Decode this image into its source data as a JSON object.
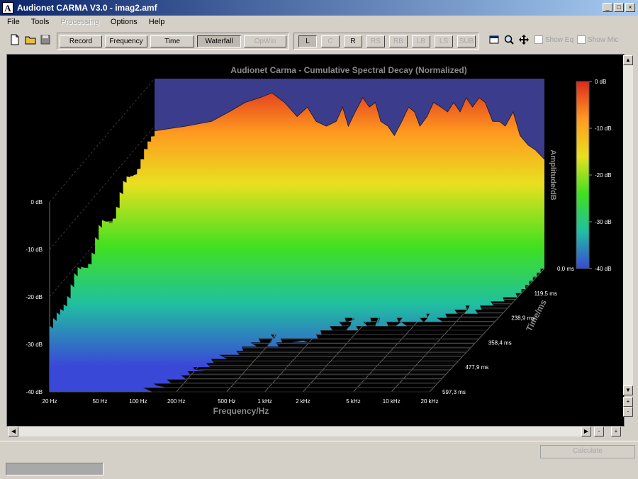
{
  "window": {
    "title": "Audionet CARMA V3.0 - imag2.amf",
    "logo_letter": "A"
  },
  "window_controls": {
    "minimize": "_",
    "maximize": "□",
    "close": "×"
  },
  "menu": [
    {
      "label": "File",
      "enabled": true
    },
    {
      "label": "Tools",
      "enabled": true
    },
    {
      "label": "Processing",
      "enabled": false
    },
    {
      "label": "Options",
      "enabled": true
    },
    {
      "label": "Help",
      "enabled": true
    }
  ],
  "toolbar": {
    "file_icons": [
      "new-file-icon",
      "open-folder-icon",
      "save-disk-icon"
    ],
    "mode_buttons": [
      {
        "label": "Record",
        "pressed": false,
        "enabled": true
      },
      {
        "label": "Frequency",
        "pressed": false,
        "enabled": true
      },
      {
        "label": "Time",
        "pressed": false,
        "enabled": true
      },
      {
        "label": "Waterfall",
        "pressed": true,
        "enabled": true
      },
      {
        "label": "OpWin",
        "pressed": false,
        "enabled": false
      }
    ],
    "channel_buttons": [
      {
        "label": "L",
        "pressed": true,
        "enabled": true
      },
      {
        "label": "C",
        "pressed": false,
        "enabled": false
      },
      {
        "label": "R",
        "pressed": false,
        "enabled": true
      },
      {
        "label": "RS",
        "pressed": false,
        "enabled": false
      },
      {
        "label": "RB",
        "pressed": false,
        "enabled": false
      },
      {
        "label": "LB",
        "pressed": false,
        "enabled": false
      },
      {
        "label": "LS",
        "pressed": false,
        "enabled": false
      },
      {
        "label": "SUB",
        "pressed": false,
        "enabled": false
      }
    ],
    "view_icons": [
      "window-icon",
      "zoom-icon",
      "pan-icon"
    ],
    "checkboxes": [
      {
        "label": "Show Eq",
        "checked": false,
        "enabled": false
      },
      {
        "label": "Show Mic",
        "checked": false,
        "enabled": false
      }
    ]
  },
  "chart_data": {
    "type": "waterfall",
    "title": "Audionet Carma - Cumulative Spectral Decay (Normalized)",
    "xlabel": "Frequency/Hz",
    "ylabel": "Amplitude/dB",
    "zlabel": "Time/ms",
    "x_ticks": [
      "20 Hz",
      "50 Hz",
      "100 Hz",
      "200 Hz",
      "500 Hz",
      "1 kHz",
      "2 kHz",
      "5 kHz",
      "10 kHz",
      "20 kHz"
    ],
    "x_tick_hz": [
      20,
      50,
      100,
      200,
      500,
      1000,
      2000,
      5000,
      10000,
      20000
    ],
    "y_ticks": [
      "0 dB",
      "-10 dB",
      "-20 dB",
      "-30 dB",
      "-40 dB"
    ],
    "y_tick_db": [
      0,
      -10,
      -20,
      -30,
      -40
    ],
    "time_ticks": [
      "0,0 ms",
      "119,5 ms",
      "238,9 ms",
      "358,4 ms",
      "477,9 ms",
      "597,3 ms"
    ],
    "time_tick_ms": [
      0,
      119.5,
      238.9,
      358.4,
      477.9,
      597.3
    ],
    "colorbar_ticks": [
      "0 dB",
      "-10 dB",
      "-20 dB",
      "-30 dB",
      "-40 dB"
    ],
    "colorbar_colors": [
      "#dd2a1e",
      "#ff9a20",
      "#e8e020",
      "#40e020",
      "#20c0a0",
      "#3a48d8"
    ],
    "xlim_hz": [
      20,
      20000
    ],
    "ylim_db": [
      -40,
      0
    ],
    "tlim_ms": [
      0,
      597.3
    ],
    "grid": true,
    "background": "#000000",
    "backwall_color": "#3c3c8c",
    "front_spectrum": {
      "x_hz": [
        20,
        35,
        55,
        75,
        100,
        130,
        160,
        200,
        250,
        300,
        350,
        420,
        500,
        560,
        620,
        700,
        800,
        900,
        1000,
        1100,
        1250,
        1400,
        1600,
        1800,
        2000,
        2200,
        2500,
        2800,
        3200,
        3600,
        4000,
        4500,
        5000,
        5600,
        6300,
        7000,
        8000,
        9000,
        10000,
        11500,
        13000,
        15000,
        17000,
        20000
      ],
      "y_db": [
        -11,
        -10,
        -9,
        -7,
        -5,
        -4,
        -3,
        -5,
        -8,
        -6,
        -9,
        -10,
        -9,
        -6,
        -10,
        -7,
        -4,
        -6,
        -5,
        -9,
        -10,
        -12,
        -9,
        -6,
        -7,
        -10,
        -8,
        -5,
        -6,
        -7,
        -5,
        -7,
        -4,
        -6,
        -4,
        -5,
        -9,
        -9,
        -10,
        -7,
        -12,
        -14,
        -15,
        -17
      ]
    }
  },
  "calculate_label": "Calculate",
  "scroll": {
    "up": "▲",
    "down": "▼",
    "left": "◀",
    "right": "▶",
    "plus": "+",
    "minus": "-"
  }
}
